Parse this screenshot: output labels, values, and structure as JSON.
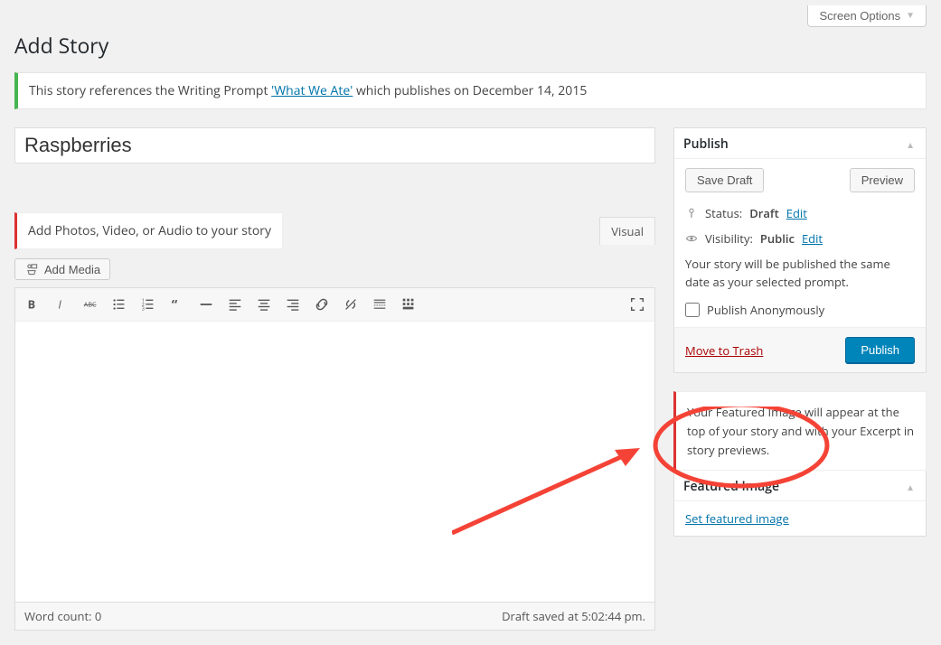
{
  "topbar": {
    "screen_options": "Screen Options"
  },
  "page": {
    "title": "Add Story"
  },
  "notice": {
    "prefix": "This story references the Writing Prompt ",
    "link": "'What We Ate'",
    "suffix": " which publishes on December 14, 2015"
  },
  "editor": {
    "title_value": "Raspberries",
    "media_hint": "Add Photos, Video, or Audio to your story",
    "visual_tab": "Visual",
    "add_media": "Add Media",
    "word_count_label": "Word count: 0",
    "draft_saved_label": "Draft saved at 5:02:44 pm."
  },
  "publish": {
    "heading": "Publish",
    "save_draft": "Save Draft",
    "preview": "Preview",
    "status_label": "Status:",
    "status_value": "Draft",
    "edit": "Edit",
    "visibility_label": "Visibility:",
    "visibility_value": "Public",
    "note": "Your story will be published the same date as your selected prompt.",
    "anon_label": "Publish Anonymously",
    "trash": "Move to Trash",
    "publish_btn": "Publish"
  },
  "featured": {
    "notice": "Your Featured Image will appear at the top of your story and with your Excerpt in story previews.",
    "heading": "Featured Image",
    "set_link": "Set featured image"
  }
}
